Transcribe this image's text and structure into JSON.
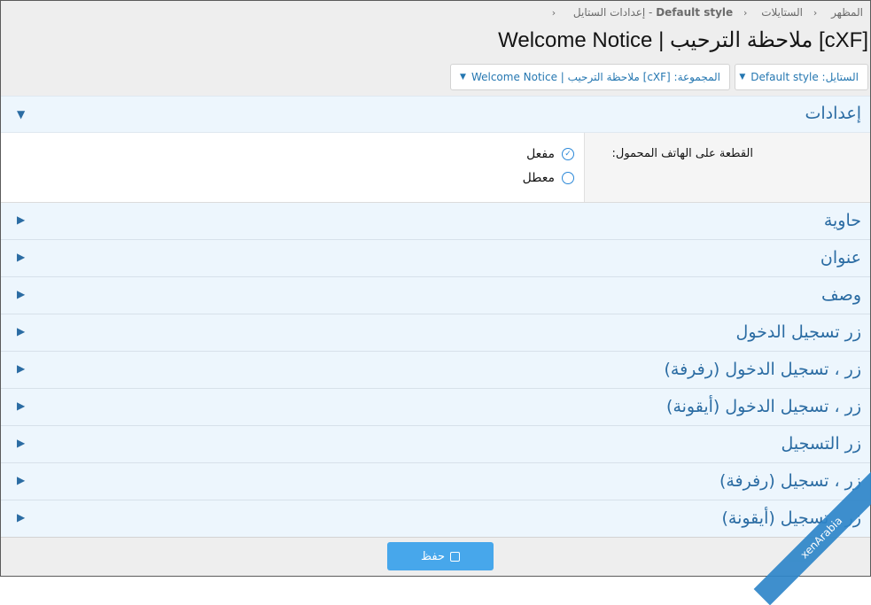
{
  "breadcrumb": {
    "items": [
      "المظهر",
      "الستايلات",
      "Default style - إعدادات الستايل"
    ],
    "bold_part": "Default style",
    "last_rest": " - إعدادات الستايل"
  },
  "page_title": "[cXF] ملاحظة الترحيب | Welcome Notice",
  "toolbar": {
    "style_select": "الستايل: Default style",
    "group_select": "المجموعة: [cXF] ملاحظة الترحيب | Welcome Notice"
  },
  "settings_section": {
    "title": "إعدادات",
    "option_label": "القطعة على الهاتف المحمول:",
    "options": [
      {
        "label": "مفعل",
        "checked": true
      },
      {
        "label": "معطل",
        "checked": false
      }
    ]
  },
  "sections": [
    "حاوية",
    "عنوان",
    "وصف",
    "زر تسجيل الدخول",
    "زر ، تسجيل الدخول (رفرفة)",
    "زر ، تسجيل الدخول (أيقونة)",
    "زر التسجيل",
    "زر ، تسجيل (رفرفة)",
    "زر ، تسجيل (أيقونة)"
  ],
  "save_button": "حفظ",
  "watermark": "xenArabia",
  "colors": {
    "accent": "#2b6ca3",
    "section_bg": "#edf6fd",
    "save_bg": "#47a7eb",
    "header_bg": "#eeeeee"
  },
  "icons": {
    "collapsed": "triangle-right-icon",
    "expanded": "triangle-down-icon",
    "checked": "check-circle-icon",
    "unchecked": "circle-icon",
    "save": "floppy-disk-icon"
  }
}
